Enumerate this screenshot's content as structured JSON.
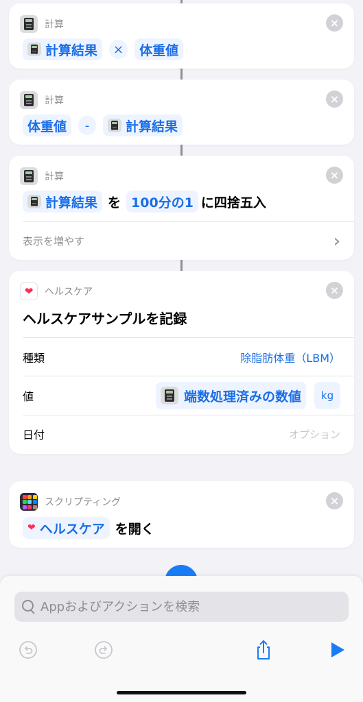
{
  "colors": {
    "accent": "#1a6ee6",
    "token_bg": "#eef4ff",
    "health_red": "#ff2d55",
    "background": "#f2f2f7"
  },
  "cards": {
    "calc1": {
      "label": "計算",
      "icon": "calculator-icon",
      "operand1": "計算結果",
      "operator": "×",
      "operand2": "体重値"
    },
    "calc2": {
      "label": "計算",
      "icon": "calculator-icon",
      "operand1": "体重値",
      "operator": "-",
      "operand2": "計算結果"
    },
    "round": {
      "label": "計算",
      "icon": "calculator-icon",
      "input": "計算結果",
      "particle": "を",
      "precision": "100分の1",
      "suffix": "に四捨五入",
      "show_more": "表示を増やす"
    },
    "health": {
      "label": "ヘルスケア",
      "icon": "health-heart-icon",
      "title": "ヘルスケアサンプルを記録",
      "type_label": "種類",
      "type_value": "除脂肪体重（LBM）",
      "value_label": "値",
      "value_token": "端数処理済みの数値",
      "unit": "kg",
      "date_label": "日付",
      "date_placeholder": "オプション"
    },
    "script": {
      "label": "スクリプティング",
      "icon": "scripting-grid-icon",
      "app_token": "ヘルスケア",
      "action_text": "を開く"
    }
  },
  "search": {
    "placeholder": "Appおよびアクションを検索"
  },
  "toolbar": {
    "undo_icon": "undo-icon",
    "redo_icon": "redo-icon",
    "share_icon": "share-icon",
    "play_icon": "play-icon"
  }
}
